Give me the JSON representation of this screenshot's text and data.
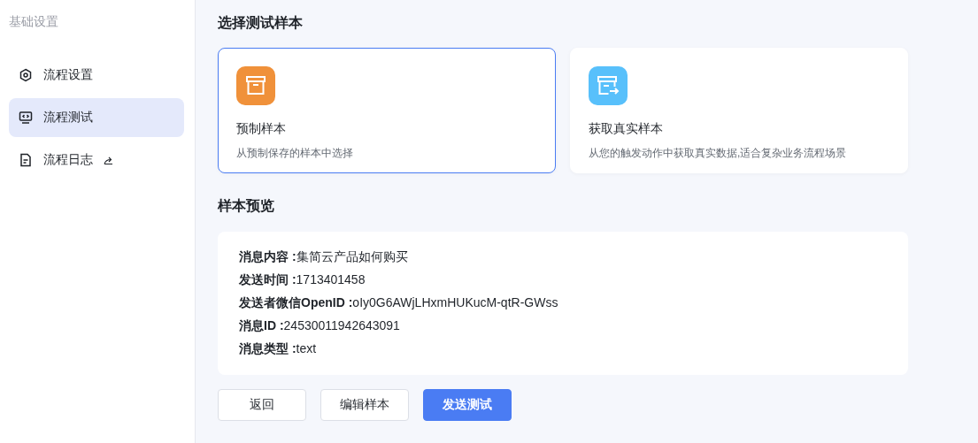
{
  "sidebar": {
    "heading": "基础设置",
    "items": [
      {
        "label": "流程设置",
        "kind": "settings",
        "selected": false,
        "external": false
      },
      {
        "label": "流程测试",
        "kind": "test",
        "selected": true,
        "external": false
      },
      {
        "label": "流程日志",
        "kind": "log",
        "selected": false,
        "external": true
      }
    ]
  },
  "sample_section": {
    "title": "选择测试样本",
    "cards": [
      {
        "kind": "preset",
        "title": "预制样本",
        "description": "从预制保存的样本中选择",
        "selected": true
      },
      {
        "kind": "fetch",
        "title": "获取真实样本",
        "description": "从您的触发动作中获取真实数据,适合复杂业务流程场景",
        "selected": false
      }
    ]
  },
  "preview": {
    "title": "样本预览",
    "lines": [
      "**消息内容 :**集简云产品如何购买",
      "**发送时间 :**1713401458",
      "**发送者微信OpenID :**oIy0G6AWjLHxmHUKucM-qtR-GWss",
      "**消息ID :**24530011942643091",
      "**消息类型 :**text"
    ]
  },
  "buttons": [
    {
      "label": "返回",
      "kind": "default"
    },
    {
      "label": "编辑样本",
      "kind": "default"
    },
    {
      "label": "发送测试",
      "kind": "primary"
    }
  ]
}
